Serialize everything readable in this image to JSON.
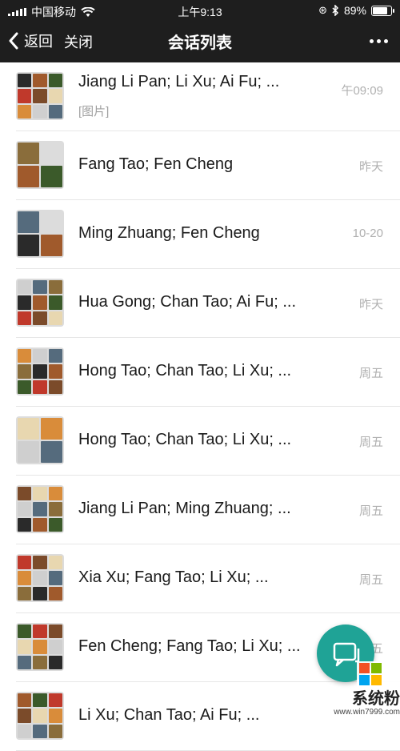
{
  "status_bar": {
    "carrier": "中国移动",
    "time": "上午9:13",
    "battery": "89%",
    "battery_level": 0.89
  },
  "nav": {
    "back_label": "返回",
    "close_label": "关闭",
    "title": "会话列表"
  },
  "conversations": [
    {
      "name": "Jiang Li Pan; Li Xu; Ai Fu; ...",
      "preview": "[图片]",
      "time": "午09:09"
    },
    {
      "name": "Fang Tao; Fen Cheng",
      "preview": "",
      "time": "昨天"
    },
    {
      "name": "Ming Zhuang; Fen Cheng",
      "preview": "",
      "time": "10-20"
    },
    {
      "name": "Hua Gong; Chan Tao; Ai Fu; ...",
      "preview": "",
      "time": "昨天"
    },
    {
      "name": "Hong Tao; Chan Tao; Li Xu; ...",
      "preview": "",
      "time": "周五"
    },
    {
      "name": "Hong Tao; Chan Tao; Li Xu; ...",
      "preview": "",
      "time": "周五"
    },
    {
      "name": "Jiang Li Pan; Ming Zhuang; ...",
      "preview": "",
      "time": "周五"
    },
    {
      "name": "Xia Xu; Fang Tao; Li Xu; ...",
      "preview": "",
      "time": "周五"
    },
    {
      "name": "Fen Cheng; Fang Tao; Li Xu; ...",
      "preview": "",
      "time": "周五"
    },
    {
      "name": "Li Xu; Chan Tao; Ai Fu; ...",
      "preview": "",
      "time": ""
    }
  ],
  "fab": {
    "icon": "chat-bubbles-icon",
    "color": "#1fa396"
  },
  "watermark": {
    "text": "系统粉",
    "url": "www.win7999.com"
  }
}
